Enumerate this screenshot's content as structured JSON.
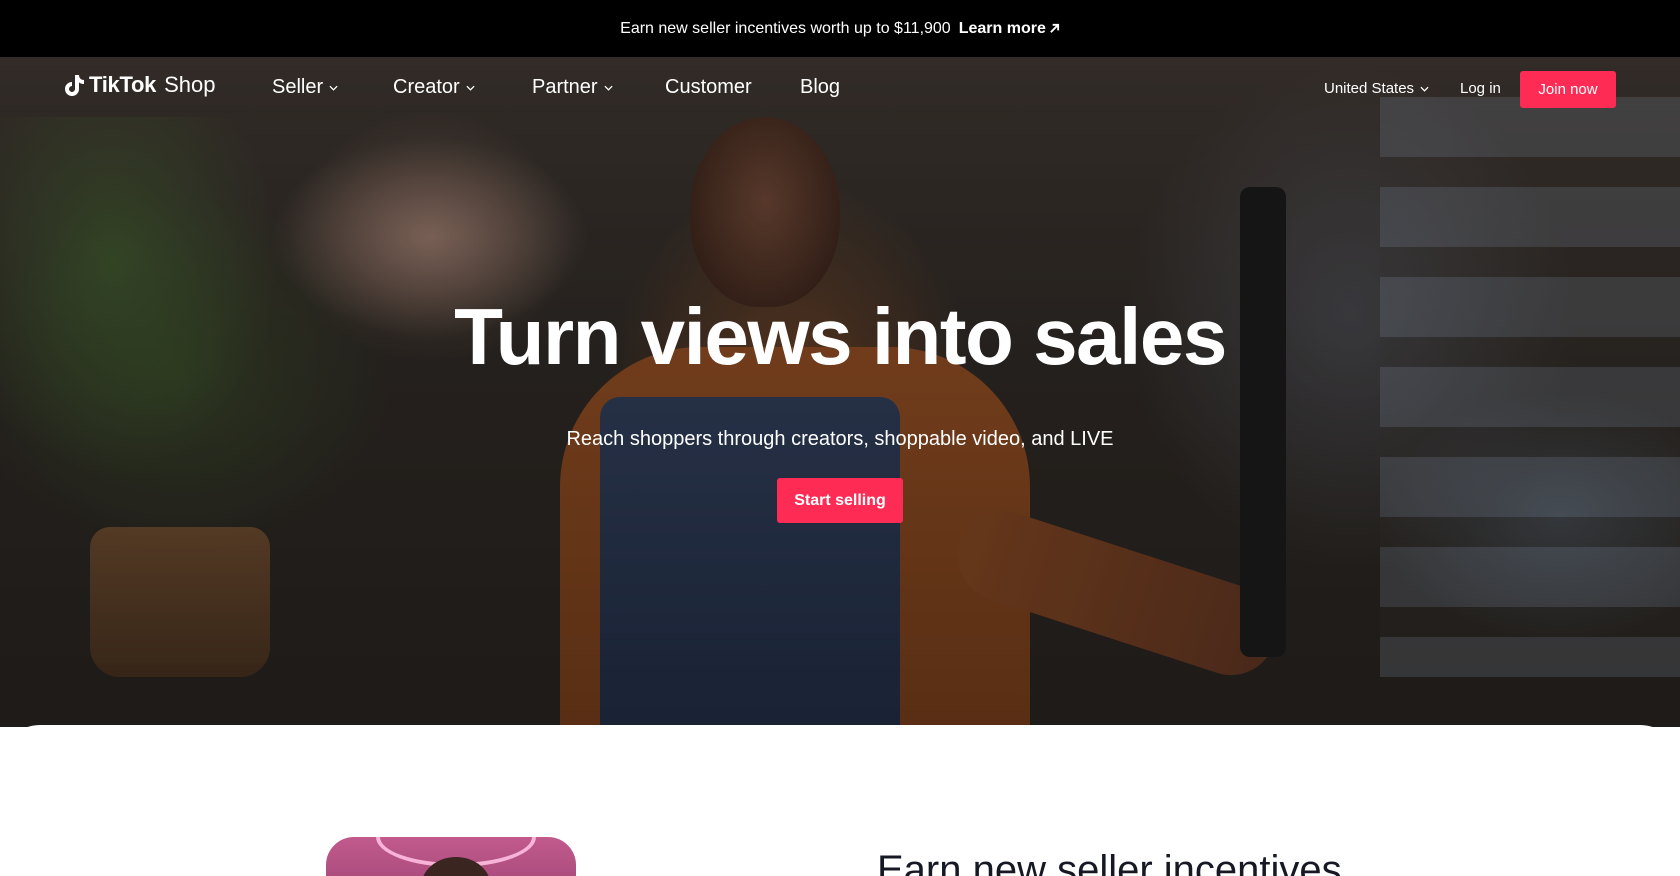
{
  "promo_bar": {
    "text": "Earn new seller incentives worth up to $11,900",
    "link_label": "Learn more"
  },
  "nav": {
    "brand": "TikTok",
    "brand_suffix": "Shop",
    "items": [
      {
        "label": "Seller",
        "has_dropdown": true
      },
      {
        "label": "Creator",
        "has_dropdown": true
      },
      {
        "label": "Partner",
        "has_dropdown": true
      },
      {
        "label": "Customer",
        "has_dropdown": false
      },
      {
        "label": "Blog",
        "has_dropdown": false
      }
    ],
    "country": "United States",
    "login_label": "Log in",
    "join_label": "Join now"
  },
  "hero": {
    "title": "Turn views into sales",
    "subtitle": "Reach shoppers through creators, shoppable video, and LIVE",
    "cta_label": "Start selling"
  },
  "section": {
    "title": "Earn new seller incentives"
  },
  "colors": {
    "accent": "#fe2c55",
    "promo_bar_bg": "#000000",
    "section_title": "#161823"
  }
}
